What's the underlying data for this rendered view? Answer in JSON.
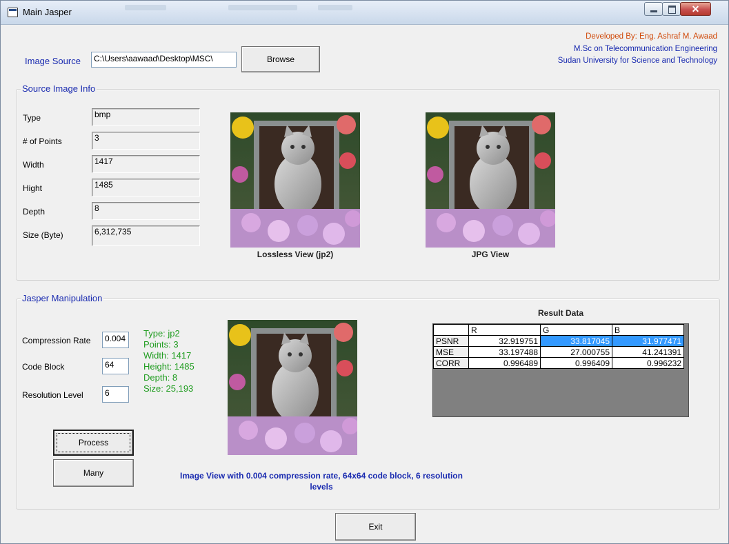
{
  "window": {
    "title": "Main Jasper"
  },
  "credits": {
    "line1": "Developed By: Eng. Ashraf M. Awaad",
    "line2": "M.Sc on Telecommunication Engineering",
    "line3": "Sudan University for Science and Technology",
    "line1_color": "#d04a0a",
    "line_color": "#1a2bb0"
  },
  "image_source": {
    "label": "Image Source",
    "value": "C:\\Users\\aawaad\\Desktop\\MSC\\",
    "browse_label": "Browse"
  },
  "source_info": {
    "title": "Source Image Info",
    "fields": [
      {
        "label": "Type",
        "value": "bmp"
      },
      {
        "label": "# of Points",
        "value": "3"
      },
      {
        "label": "Width",
        "value": "1417"
      },
      {
        "label": "Hight",
        "value": "1485"
      },
      {
        "label": "Depth",
        "value": "8"
      },
      {
        "label": "Size (Byte)",
        "value": "6,312,735"
      }
    ],
    "lossless_caption": "Lossless View (jp2)",
    "jpg_caption": "JPG View"
  },
  "jasper": {
    "title": "Jasper Manipulation",
    "compression_label": "Compression Rate",
    "compression_value": "0.004",
    "codeblock_label": "Code Block",
    "codeblock_value": "64",
    "resolution_label": "Resolution Level",
    "resolution_value": "6",
    "info": [
      "Type: jp2",
      "Points: 3",
      "Width: 1417",
      "Height: 1485",
      "Depth: 8",
      "Size: 25,193"
    ],
    "process_label": "Process",
    "many_label": "Many",
    "view_caption_line1": "Image View with 0.004 compression rate, 64x64 code block, 6 resolution",
    "view_caption_line2": "levels"
  },
  "result": {
    "title": "Result Data",
    "columns": [
      "R",
      "G",
      "B"
    ],
    "rows": [
      {
        "name": "PSNR",
        "values": [
          "32.919751",
          "33.817045",
          "31.977471"
        ]
      },
      {
        "name": "MSE",
        "values": [
          "33.197488",
          "27.000755",
          "41.241391"
        ]
      },
      {
        "name": "CORR",
        "values": [
          "0.996489",
          "0.996409",
          "0.996232"
        ]
      }
    ],
    "selection_color": "#3399ff"
  },
  "exit_label": "Exit"
}
